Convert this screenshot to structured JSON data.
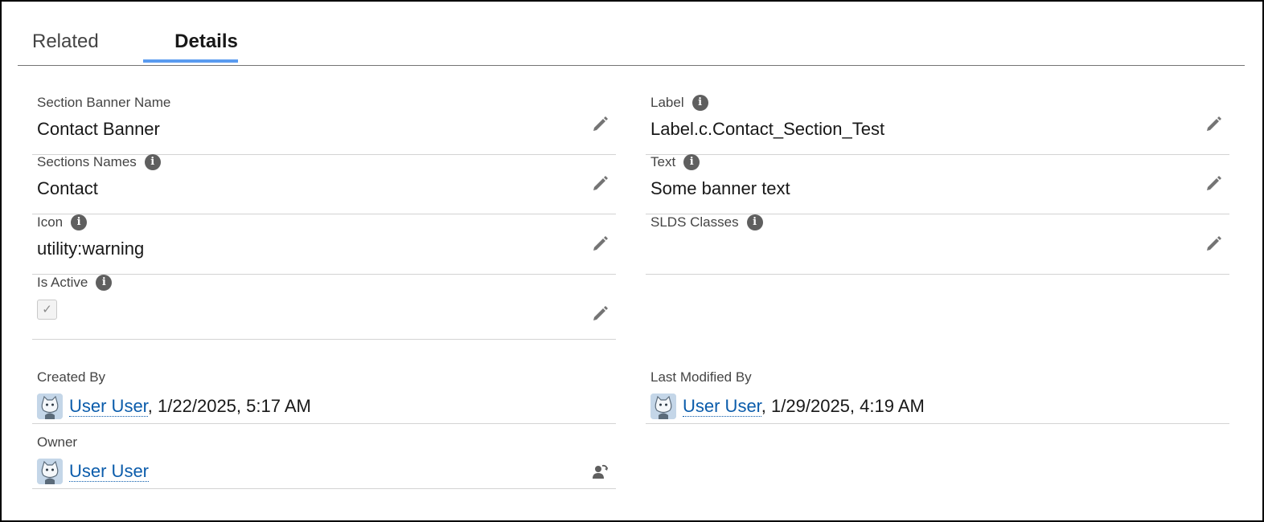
{
  "tabs": {
    "related": "Related",
    "details": "Details"
  },
  "fields": {
    "section_banner_name": {
      "label": "Section Banner Name",
      "value": "Contact Banner"
    },
    "sections_names": {
      "label": "Sections Names",
      "value": "Contact"
    },
    "icon": {
      "label": "Icon",
      "value": "utility:warning"
    },
    "is_active": {
      "label": "Is Active",
      "checked": true
    },
    "label": {
      "label": "Label",
      "value": "Label.c.Contact_Section_Test"
    },
    "text": {
      "label": "Text",
      "value": "Some banner text"
    },
    "slds_classes": {
      "label": "SLDS Classes",
      "value": ""
    },
    "created_by": {
      "label": "Created By",
      "user": "User User",
      "separator": ",",
      "date": "1/22/2025, 5:17 AM"
    },
    "last_modified_by": {
      "label": "Last Modified By",
      "user": "User User",
      "separator": ",",
      "date": "1/29/2025, 4:19 AM"
    },
    "owner": {
      "label": "Owner",
      "user": "User User"
    }
  },
  "icons": {
    "info": "i",
    "checkmark": "✓",
    "edit": "pencil-icon",
    "change_owner": "change-owner-icon",
    "avatar": "user-avatar-icon"
  },
  "colors": {
    "tab_active_underline": "#5a9bf0",
    "link": "#0b5cab",
    "icon_gray": "#747474"
  }
}
